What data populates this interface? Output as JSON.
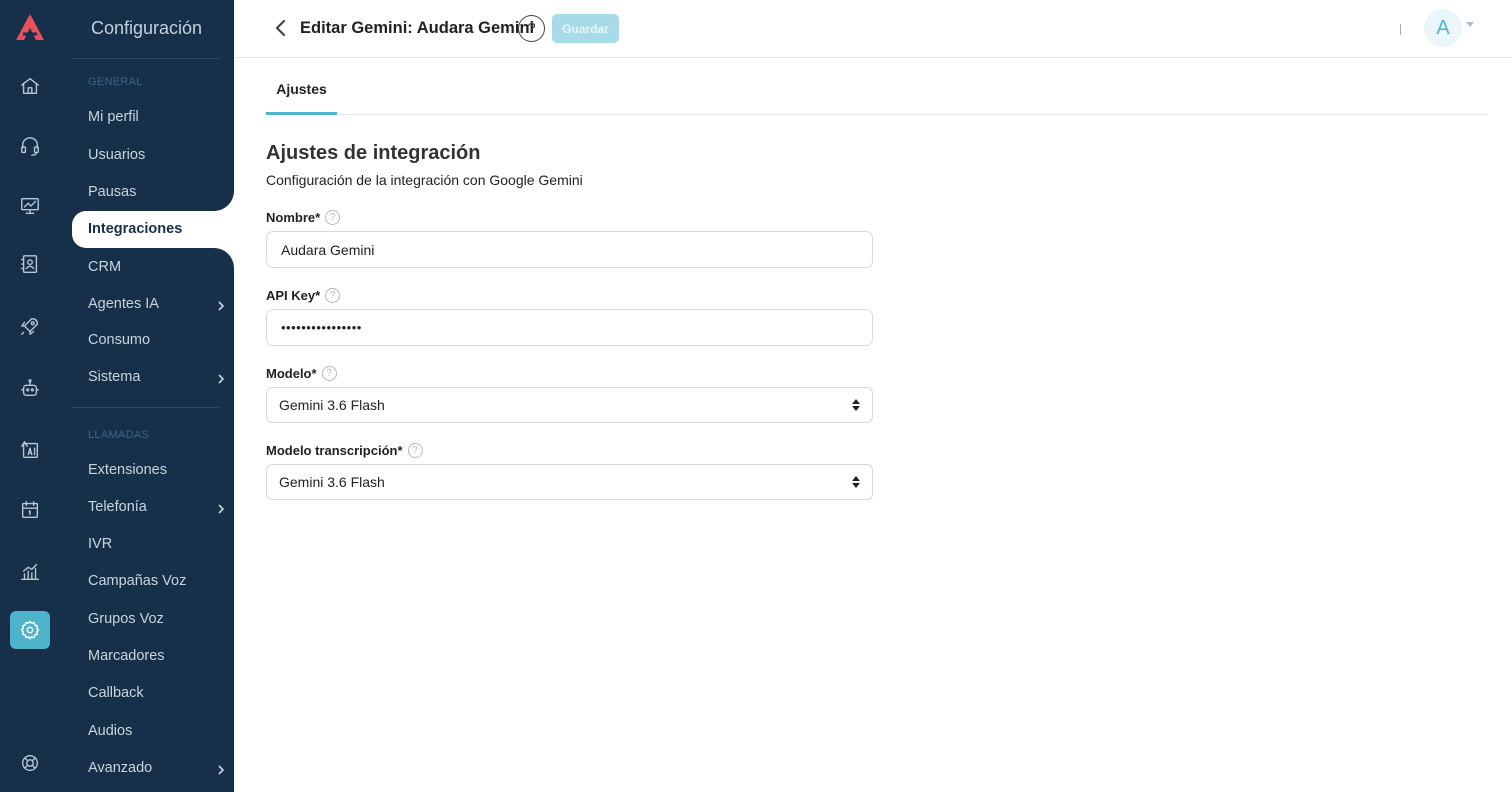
{
  "brand": {
    "logo_icon": "audara-logo-icon",
    "accent_color": "#4fb3cc",
    "sidebar_color": "#163049"
  },
  "rail": {
    "items": [
      {
        "icon": "home-icon"
      },
      {
        "icon": "headset-icon"
      },
      {
        "icon": "monitor-icon"
      },
      {
        "icon": "contacts-book-icon"
      },
      {
        "icon": "rocket-icon"
      },
      {
        "icon": "robot-icon"
      },
      {
        "icon": "ai-icon"
      },
      {
        "icon": "calendar-icon"
      },
      {
        "icon": "chart-icon"
      },
      {
        "icon": "gear-icon",
        "active": true
      },
      {
        "icon": "support-icon"
      }
    ]
  },
  "sidebar": {
    "title": "Configuración",
    "section_general": "GENERAL",
    "section_calls": "LLAMADAS",
    "items": [
      {
        "label": "Mi perfil"
      },
      {
        "label": "Usuarios"
      },
      {
        "label": "Pausas"
      },
      {
        "label": "Integraciones",
        "active": true
      },
      {
        "label": "CRM"
      },
      {
        "label": "Agentes IA",
        "has_submenu": true
      },
      {
        "label": "Consumo"
      },
      {
        "label": "Sistema",
        "has_submenu": true
      },
      {
        "label": "Extensiones"
      },
      {
        "label": "Telefonía",
        "has_submenu": true
      },
      {
        "label": "IVR"
      },
      {
        "label": "Campañas Voz"
      },
      {
        "label": "Grupos Voz"
      },
      {
        "label": "Marcadores"
      },
      {
        "label": "Callback"
      },
      {
        "label": "Audios"
      },
      {
        "label": "Avanzado",
        "has_submenu": true
      }
    ]
  },
  "header": {
    "title": "Editar Gemini: Audara Gemini",
    "help_label": "?",
    "save_label": "Guardar",
    "avatar_initial": "A"
  },
  "tabs": [
    {
      "label": "Ajustes",
      "active": true
    }
  ],
  "form": {
    "title": "Ajustes de integración",
    "subtitle": "Configuración de la integración con Google Gemini",
    "name_label": "Nombre*",
    "name_value": "Audara Gemini",
    "apikey_label": "API Key*",
    "apikey_value": "••••••••••••••••",
    "model_label": "Modelo*",
    "model_value": "Gemini 3.6 Flash",
    "transcription_label": "Modelo transcripción*",
    "transcription_value": "Gemini 3.6 Flash",
    "help_glyph": "?"
  }
}
